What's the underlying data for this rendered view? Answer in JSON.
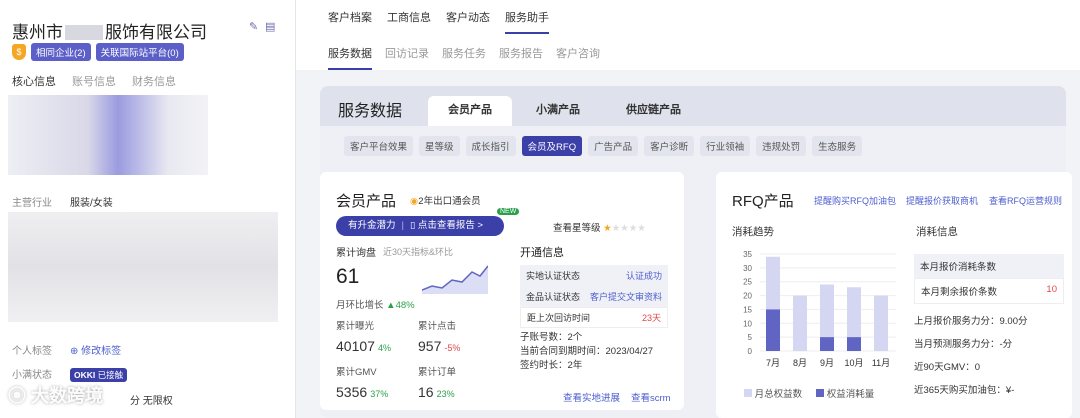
{
  "company": {
    "name_prefix": "惠州市",
    "name_suffix": "服饰有限公司",
    "badge_related": "相同企业(2)",
    "badge_intl": "关联国际站平台(0)"
  },
  "left_tabs": [
    "核心信息",
    "账号信息",
    "财务信息"
  ],
  "fields": {
    "industry_label": "主营行业",
    "industry_value": "服装/女装",
    "tag_label": "个人标签",
    "tag_action": "修改标签",
    "xiaoman_label": "小满状态",
    "okki": "OKKI",
    "okki_status": "已接触",
    "bottom_text": "分 无限权"
  },
  "watermark": "大数跨境",
  "nav1": [
    "客户档案",
    "工商信息",
    "客户动态",
    "服务助手"
  ],
  "nav2": [
    "服务数据",
    "回访记录",
    "服务任务",
    "服务报告",
    "客户咨询"
  ],
  "panel": {
    "title": "服务数据",
    "tabs": [
      "会员产品",
      "小满产品",
      "供应链产品"
    ]
  },
  "chips": [
    "客户平台效果",
    "星等级",
    "成长指引",
    "会员及RFQ",
    "广告产品",
    "客户诊断",
    "行业领袖",
    "违规处罚",
    "生态服务"
  ],
  "member": {
    "title": "会员产品",
    "tag": "2年出口通会员",
    "btn_potential": "有升金潜力",
    "btn_report": "点击查看报告 >",
    "new": "NEW",
    "star_link": "查看星等级",
    "inquiry_label": "累计询盘",
    "inquiry_sub": "近30天指标&环比",
    "inquiry_value": "61",
    "mom_label": "月环比增长",
    "mom_value": "48%",
    "stats": [
      {
        "label": "累计曝光",
        "value": "40107",
        "pct": "4%",
        "color": "g"
      },
      {
        "label": "累计点击",
        "value": "957",
        "pct": "-5%",
        "color": "r"
      },
      {
        "label": "累计GMV",
        "value": "5356",
        "pct": "37%",
        "color": "g"
      },
      {
        "label": "累计订单",
        "value": "16",
        "pct": "23%",
        "color": "g"
      }
    ],
    "open_title": "开通信息",
    "open_rows": [
      {
        "k": "实地认证状态",
        "v": "认证成功",
        "c": "link"
      },
      {
        "k": "金品认证状态",
        "v": "客户提交文审资料",
        "c": "link"
      },
      {
        "k": "距上次回访时间",
        "v": "23天",
        "c": "r"
      }
    ],
    "sub_accounts": "子账号数：2个",
    "contract_end": "当前合同到期时间：2023/04/27",
    "sign_years": "签约时长：2年",
    "link_visit": "查看实地进展",
    "link_scrm": "查看scrm"
  },
  "rfq": {
    "title": "RFQ产品",
    "links": [
      "提醒购买RFQ加油包",
      "提醒报价获取商机",
      "查看RFQ运营规则"
    ],
    "trend_title": "消耗趋势",
    "consume_title": "消耗信息",
    "rows": [
      {
        "k": "本月报价消耗条数",
        "v": ""
      },
      {
        "k": "本月剩余报价条数",
        "v": "10"
      }
    ],
    "lines": [
      "上月报价服务力分：9.00分",
      "当月预测服务力分：-分",
      "近90天GMV：0",
      "近365天购买加油包：¥-"
    ]
  },
  "chart_data": {
    "type": "bar",
    "categories": [
      "7月",
      "8月",
      "9月",
      "10月",
      "11月"
    ],
    "series": [
      {
        "name": "月总权益数",
        "values": [
          34,
          20,
          24,
          23,
          20
        ],
        "color": "#d4d6f2"
      },
      {
        "name": "权益消耗量",
        "values": [
          15,
          0,
          5,
          5,
          0
        ],
        "color": "#6065c4"
      }
    ],
    "yticks": [
      0,
      5,
      10,
      15,
      20,
      25,
      30,
      35
    ],
    "ylim": [
      0,
      35
    ]
  }
}
